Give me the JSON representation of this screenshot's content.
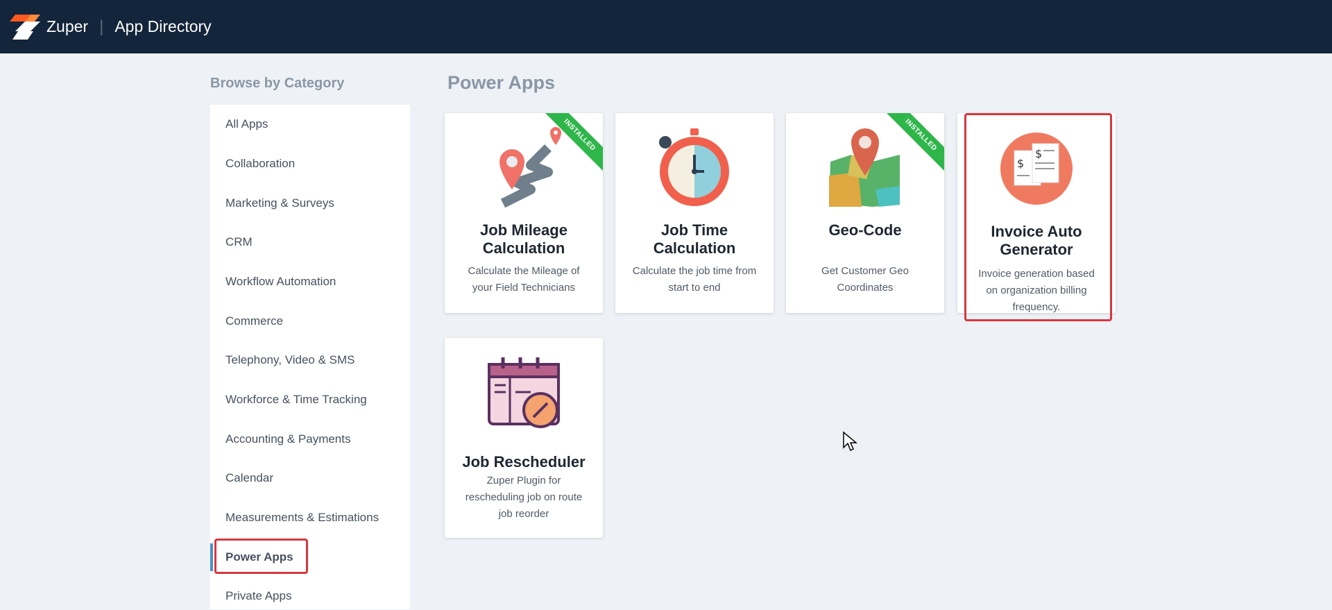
{
  "header": {
    "brand": "Zuper",
    "title": "App Directory"
  },
  "sidebar": {
    "title": "Browse by Category",
    "items": [
      {
        "label": "All Apps"
      },
      {
        "label": "Collaboration"
      },
      {
        "label": "Marketing & Surveys"
      },
      {
        "label": "CRM"
      },
      {
        "label": "Workflow Automation"
      },
      {
        "label": "Commerce"
      },
      {
        "label": "Telephony, Video & SMS"
      },
      {
        "label": "Workforce & Time Tracking"
      },
      {
        "label": "Accounting & Payments"
      },
      {
        "label": "Calendar"
      },
      {
        "label": "Measurements & Estimations"
      },
      {
        "label": "Power Apps"
      },
      {
        "label": "Private Apps"
      }
    ],
    "active_item": "Power Apps"
  },
  "main": {
    "title": "Power Apps",
    "apps": [
      {
        "name": "Job Mileage Calculation",
        "description": "Calculate the Mileage of your Field Technicians",
        "badge": "INSTALLED",
        "icon": "route-map-icon"
      },
      {
        "name": "Job Time Calculation",
        "description": "Calculate the job time from start to end",
        "badge": "",
        "icon": "stopwatch-icon"
      },
      {
        "name": "Geo-Code",
        "description": "Get Customer Geo Coordinates",
        "badge": "INSTALLED",
        "icon": "map-pin-icon"
      },
      {
        "name": "Invoice Auto Generator",
        "description": "Invoice generation based on organization billing frequency.",
        "badge": "",
        "icon": "invoice-icon"
      },
      {
        "name": "Job Rescheduler",
        "description": "Zuper Plugin for rescheduling job on route job reorder",
        "badge": "",
        "icon": "calendar-edit-icon"
      }
    ]
  },
  "colors": {
    "topbar": "#13253a",
    "accent_active": "#4a90c8",
    "highlight": "#d9363e",
    "installed_ribbon": "#2fb64a"
  }
}
